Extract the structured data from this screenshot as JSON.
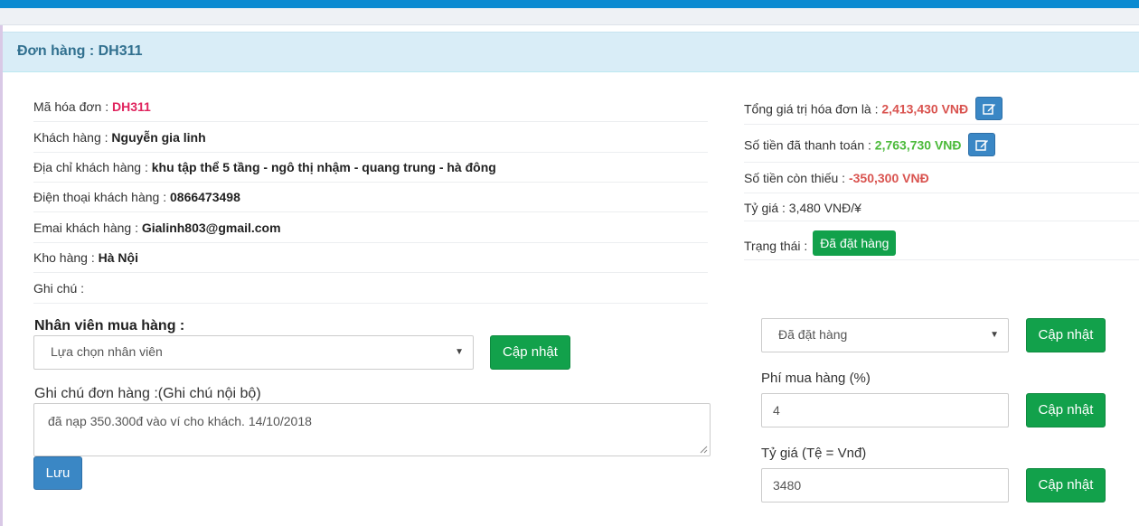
{
  "header": {
    "title": "Đơn hàng : DH311"
  },
  "order_info": {
    "invoice_code_label": "Mã hóa đơn : ",
    "invoice_code": "DH311",
    "customer_label": "Khách hàng : ",
    "customer": "Nguyễn gia linh",
    "address_label": "Địa chỉ khách hàng : ",
    "address": "khu tập thể 5 tầng - ngô thị nhậm - quang trung - hà đông",
    "phone_label": "Điện thoại khách hàng : ",
    "phone": "0866473498",
    "email_label": "Emai khách hàng : ",
    "email": "Gialinh803@gmail.com",
    "warehouse_label": "Kho hàng : ",
    "warehouse": "Hà Nội",
    "note_label": "Ghi chú :",
    "note": ""
  },
  "summary": {
    "total_label": "Tổng giá trị hóa đơn là : ",
    "total": "2,413,430 VNĐ",
    "paid_label": "Số tiền đã thanh toán : ",
    "paid": "2,763,730 VNĐ",
    "due_label": "Số tiền còn thiếu : ",
    "due": "-350,300 VNĐ",
    "rate_label": "Tỷ giá : ",
    "rate": "3,480 VNĐ/¥",
    "status_label": "Trạng thái : ",
    "status": "Đã đặt hàng"
  },
  "staff": {
    "title": "Nhân viên mua hàng :",
    "select_value": "Lựa chọn nhân viên",
    "update_label": "Cập nhật"
  },
  "internal_note": {
    "label": "Ghi chú đơn hàng :(Ghi chú nội bộ)",
    "value": "đã nạp 350.300đ vào ví cho khách. 14/10/2018",
    "save_label": "Lưu"
  },
  "right_form": {
    "status_select": "Đã đặt hàng",
    "status_update": "Cập nhật",
    "fee_label": "Phí mua hàng (%)",
    "fee_value": "4",
    "fee_update": "Cập nhật",
    "rate_label": "Tỷ giá (Tệ = Vnđ)",
    "rate_value": "3480",
    "rate_update": "Cập nhật"
  },
  "icons": {
    "edit": "edit-icon",
    "dropdown": "chevron-down-icon"
  },
  "colors": {
    "accent_bar": "#0b8ad1",
    "panel_head": "#d9edf7",
    "green": "#12a14b",
    "blue": "#3a87c5",
    "amount_red": "#d9534f",
    "amount_green": "#4cba3b",
    "code_pink": "#e0245e"
  }
}
